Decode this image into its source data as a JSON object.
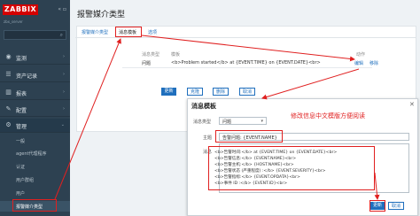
{
  "sidebar": {
    "logo": "ZABBIX",
    "server_name": "zbx_server",
    "search_placeholder": "",
    "items": [
      {
        "label": "监测",
        "icon": "eye-icon"
      },
      {
        "label": "资产记录",
        "icon": "list-icon"
      },
      {
        "label": "报表",
        "icon": "chart-icon"
      },
      {
        "label": "配置",
        "icon": "wrench-icon"
      },
      {
        "label": "管理",
        "icon": "gear-icon"
      }
    ],
    "sub_items": [
      "一般",
      "agent代理程序",
      "认证",
      "用户群组",
      "用户",
      "报警媒介类型"
    ]
  },
  "header": {
    "title": "报警媒介类型"
  },
  "tabs": [
    "报警媒介类型",
    "消息模板",
    "选项"
  ],
  "table": {
    "headers": [
      "消息类型",
      "模板",
      "动作"
    ],
    "row": {
      "type": "问题",
      "template": "<b>Problem started</b> at {EVENT.TIME} on {EVENT.DATE}<br>",
      "edit": "编辑",
      "remove": "移除"
    }
  },
  "buttons": {
    "update": "更新",
    "clone": "克隆",
    "delete": "删除",
    "cancel": "取消"
  },
  "dialog": {
    "title": "消息模板",
    "annotation": "修改信息中文模版方便阅读",
    "type_label": "消息类型",
    "type_value": "问题",
    "subject_label": "主题",
    "subject_value": "告警问题: {EVENT.NAME}",
    "message_label": "消息",
    "message_lines": [
      "<b>告警时间:</b> at {EVENT.TIME} on {EVENT.DATE}<br>",
      "<b>告警信息:</b> {EVENT.NAME}<br>",
      "<b>告警主机:</b> {HOST.NAME}<br>",
      "<b>告警状态 (严重程度) :</b> {EVENT.SEVERITY}<br>",
      "<b>告警指标:</b> {EVENT.OPDATA}<br>",
      "<b>事件 ID :</b> {EVENT.ID}<br>"
    ],
    "update": "更新",
    "cancel": "取消"
  }
}
